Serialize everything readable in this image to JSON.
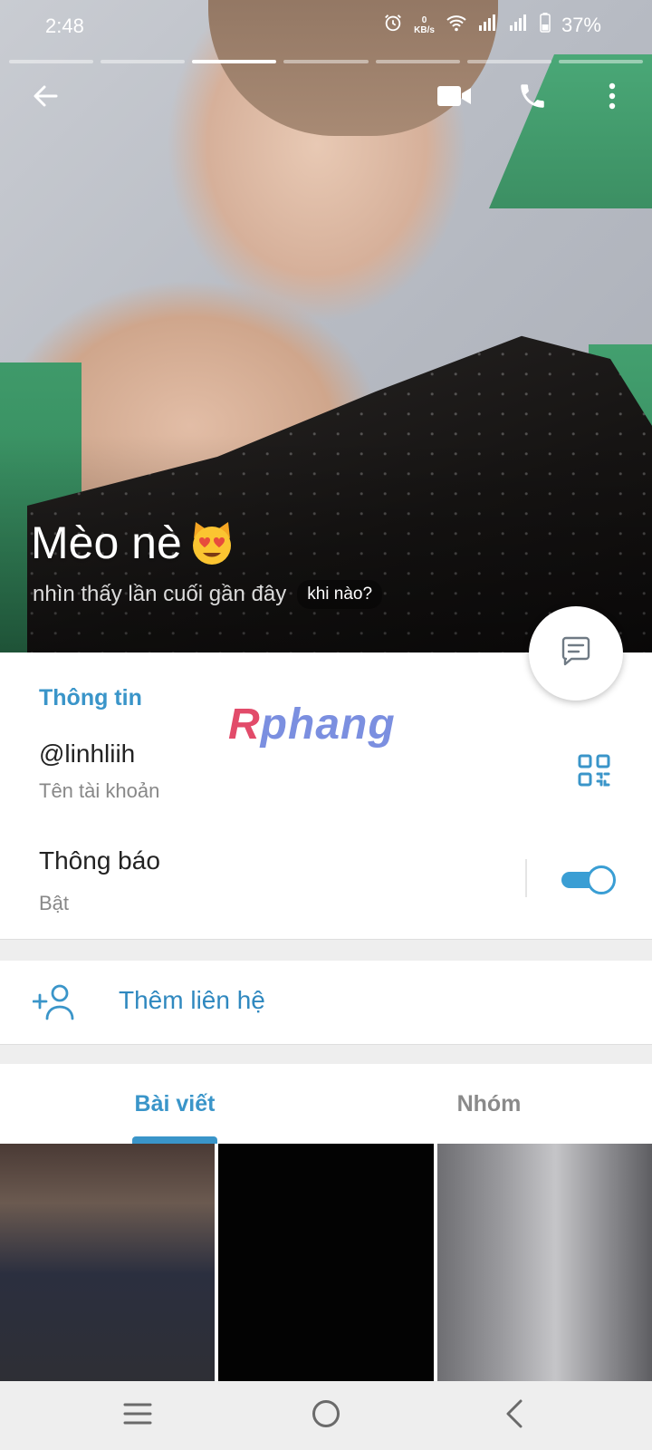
{
  "status_bar": {
    "time": "2:48",
    "net_speed_value": "0",
    "net_speed_unit": "KB/s",
    "battery_percent": "37%"
  },
  "story_progress": {
    "segments": 7,
    "active_index": 2
  },
  "profile": {
    "name": "Mèo nè",
    "last_seen": "nhìn thấy lần cuối gần đây",
    "when_chip": "khi nào?"
  },
  "info": {
    "section_title": "Thông tin",
    "username": "@linhliih",
    "username_caption": "Tên tài khoản",
    "notifications_label": "Thông báo",
    "notifications_status": "Bật",
    "notifications_on": true
  },
  "watermark": {
    "text_accent": "R",
    "text_main": "phang"
  },
  "add_contact": {
    "label": "Thêm liên hệ"
  },
  "tabs": [
    {
      "label": "Bài viết",
      "active": true
    },
    {
      "label": "Nhóm",
      "active": false
    }
  ],
  "colors": {
    "accent": "#3a95c9",
    "toggle": "#3a9ed4",
    "link": "#2f88bf"
  },
  "icons": {
    "back": "arrow-left-icon",
    "video": "video-camera-icon",
    "call": "phone-icon",
    "more": "more-vertical-icon",
    "message": "message-icon",
    "qr": "qr-code-icon",
    "add_contact": "add-person-icon",
    "emoji": "heart-eyes-cat-emoji"
  }
}
